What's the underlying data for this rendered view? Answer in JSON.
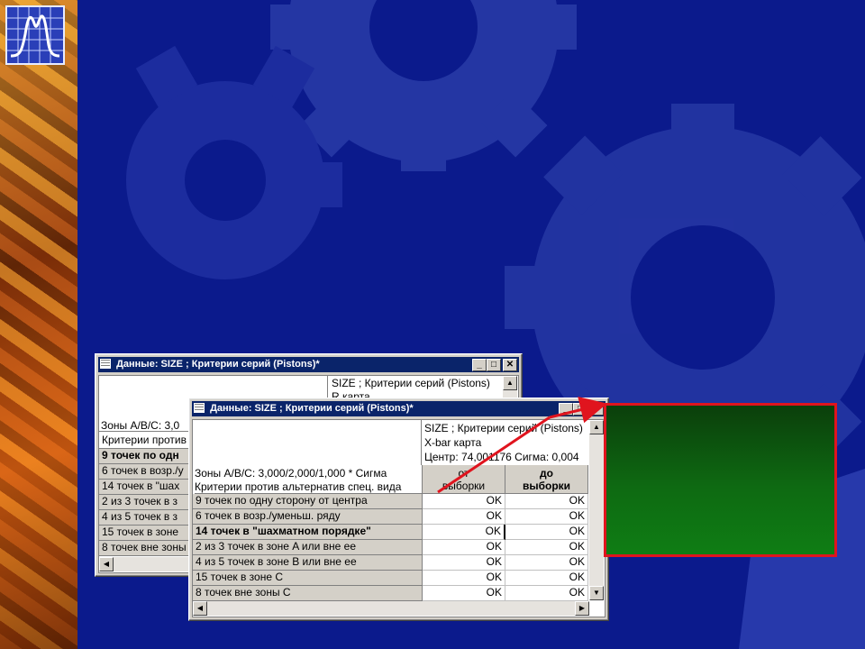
{
  "colors": {
    "background": "#0b1a8c",
    "gear": "#2a3ca8",
    "title_bar": "#0a246a",
    "highlight_border": "#e0141e",
    "panel": "#0f7d14"
  },
  "back_window": {
    "title": "Данные: SIZE ; Критерии серий (Pistons)*",
    "header_line1": "SIZE ; Критерии серий (Pistons)",
    "header_line2": "R карта",
    "zones_partial": "Зоны  A/B/C:  3,0",
    "criteria_partial": "Критерии против",
    "rows": [
      "9 точек по одн",
      "6 точек в возр./у",
      "14 точек в \"шах",
      "2 из  3 точек в з",
      "4 из  5 точек в з",
      "15 точек в зоне",
      "8 точек вне зоны"
    ]
  },
  "front_window": {
    "title": "Данные: SIZE ; Критерии серий (Pistons)*",
    "header_line1": "SIZE ; Критерии серий (Pistons)",
    "header_line2": "X-bar карта",
    "header_line3": "Центр: 74,001176 Сигма: 0,004",
    "zones_label": "Зоны  A/B/C:  3,000/2,000/1,000  * Сигма",
    "criteria_label": "Критерии против альтернатив спец. вида",
    "col1_line1": "от",
    "col1_line2": "выборки",
    "col2_line1": "до",
    "col2_line2": "выборки",
    "rows": [
      {
        "label": "9 точек по одну сторону от центра",
        "v1": "OK",
        "v2": "OK"
      },
      {
        "label": "6 точек в возр./уменьш. ряду",
        "v1": "OK",
        "v2": "OK"
      },
      {
        "label": "14 точек в \"шахматном порядке\"",
        "v1": "OK",
        "v2": "OK"
      },
      {
        "label": "2 из  3 точек в зоне A или вне ее",
        "v1": "OK",
        "v2": "OK"
      },
      {
        "label": "4 из  5 точек в зоне B или вне ее",
        "v1": "OK",
        "v2": "OK"
      },
      {
        "label": "15 точек в зоне C",
        "v1": "OK",
        "v2": "OK"
      },
      {
        "label": "8 точек вне зоны C",
        "v1": "OK",
        "v2": "OK"
      }
    ]
  },
  "icons": {
    "logo": "normal-distribution-chart-icon",
    "table": "table-grid-icon",
    "minimize": "minimize-icon",
    "maximize": "maximize-icon",
    "close": "close-icon",
    "scroll_up": "scroll-up-arrow-icon",
    "scroll_down": "scroll-down-arrow-icon",
    "scroll_left": "scroll-left-arrow-icon",
    "scroll_right": "scroll-right-arrow-icon"
  },
  "glyphs": {
    "minimize": "_",
    "maximize": "□",
    "close": "✕",
    "up": "▲",
    "down": "▼",
    "left": "◀",
    "right": "▶"
  }
}
